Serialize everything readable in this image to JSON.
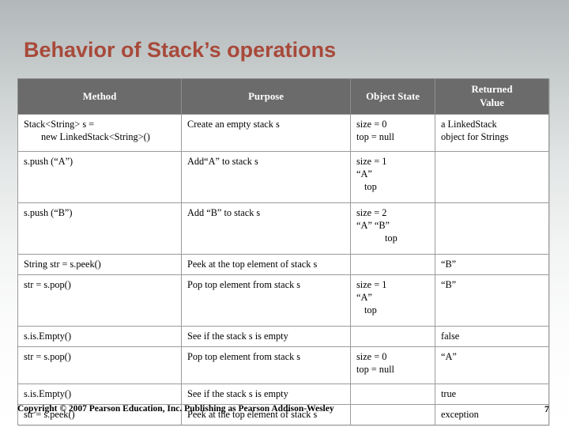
{
  "slide": {
    "title": "Behavior of Stack’s operations",
    "title_color": "#a8493a",
    "header_bg": "#6b6b6b",
    "border_color": "#9b9b9b"
  },
  "table": {
    "headers": {
      "method": "Method",
      "purpose": "Purpose",
      "object_state": "Object State",
      "returned_value_line1": "Returned",
      "returned_value_line2": "Value"
    },
    "rows": [
      {
        "method_l1": "Stack<String> s =",
        "method_l2": "new LinkedStack<String>()",
        "purpose_l1": "Create an empty stack s",
        "purpose_l2": "",
        "state_l1": "size = 0",
        "state_l2": "top = null",
        "state_l3": "",
        "returned_l1": "a LinkedStack",
        "returned_l2": "object for Strings"
      },
      {
        "method_l1": "s.push (“A”)",
        "method_l2": "",
        "purpose_l1": "Add“A” to stack s",
        "purpose_l2": "",
        "state_l1": "size = 1",
        "state_l2": "“A”",
        "state_l3": "top",
        "returned_l1": "",
        "returned_l2": ""
      },
      {
        "method_l1": "s.push (“B”)",
        "method_l2": "",
        "purpose_l1": "Add “B” to stack s",
        "purpose_l2": "",
        "state_l1": "size = 2",
        "state_l2": "“A” “B”",
        "state_l3": "top",
        "returned_l1": "",
        "returned_l2": ""
      },
      {
        "method_l1": "String str = s.peek()",
        "method_l2": "",
        "purpose_l1": "Peek at the top element of stack s",
        "purpose_l2": "",
        "state_l1": "",
        "state_l2": "",
        "state_l3": "",
        "returned_l1": "“B”",
        "returned_l2": ""
      },
      {
        "method_l1": "str = s.pop()",
        "method_l2": "",
        "purpose_l1": "Pop top element from stack s",
        "purpose_l2": "",
        "state_l1": "size = 1",
        "state_l2": "“A”",
        "state_l3": "top",
        "returned_l1": "“B”",
        "returned_l2": ""
      },
      {
        "method_l1": "s.is.Empty()",
        "method_l2": "",
        "purpose_l1": "See if the stack s is empty",
        "purpose_l2": "",
        "state_l1": "",
        "state_l2": "",
        "state_l3": "",
        "returned_l1": "false",
        "returned_l2": ""
      },
      {
        "method_l1": "str = s.pop()",
        "method_l2": "",
        "purpose_l1": "Pop top element from stack s",
        "purpose_l2": "",
        "state_l1": "size = 0",
        "state_l2": "top = null",
        "state_l3": "",
        "returned_l1": "“A”",
        "returned_l2": ""
      },
      {
        "method_l1": "s.is.Empty()",
        "method_l2": "",
        "purpose_l1": "See if the stack s is empty",
        "purpose_l2": "",
        "state_l1": "",
        "state_l2": "",
        "state_l3": "",
        "returned_l1": "true",
        "returned_l2": ""
      },
      {
        "method_l1": "str = s.peek()",
        "method_l2": "",
        "purpose_l1": "Peek at the top element of stack s",
        "purpose_l2": "",
        "state_l1": "",
        "state_l2": "",
        "state_l3": "",
        "returned_l1": "exception",
        "returned_l2": ""
      }
    ]
  },
  "footer": {
    "copyright": "Copyright © 2007 Pearson Education, Inc. Publishing as Pearson Addison-Wesley",
    "page_number": "7"
  }
}
